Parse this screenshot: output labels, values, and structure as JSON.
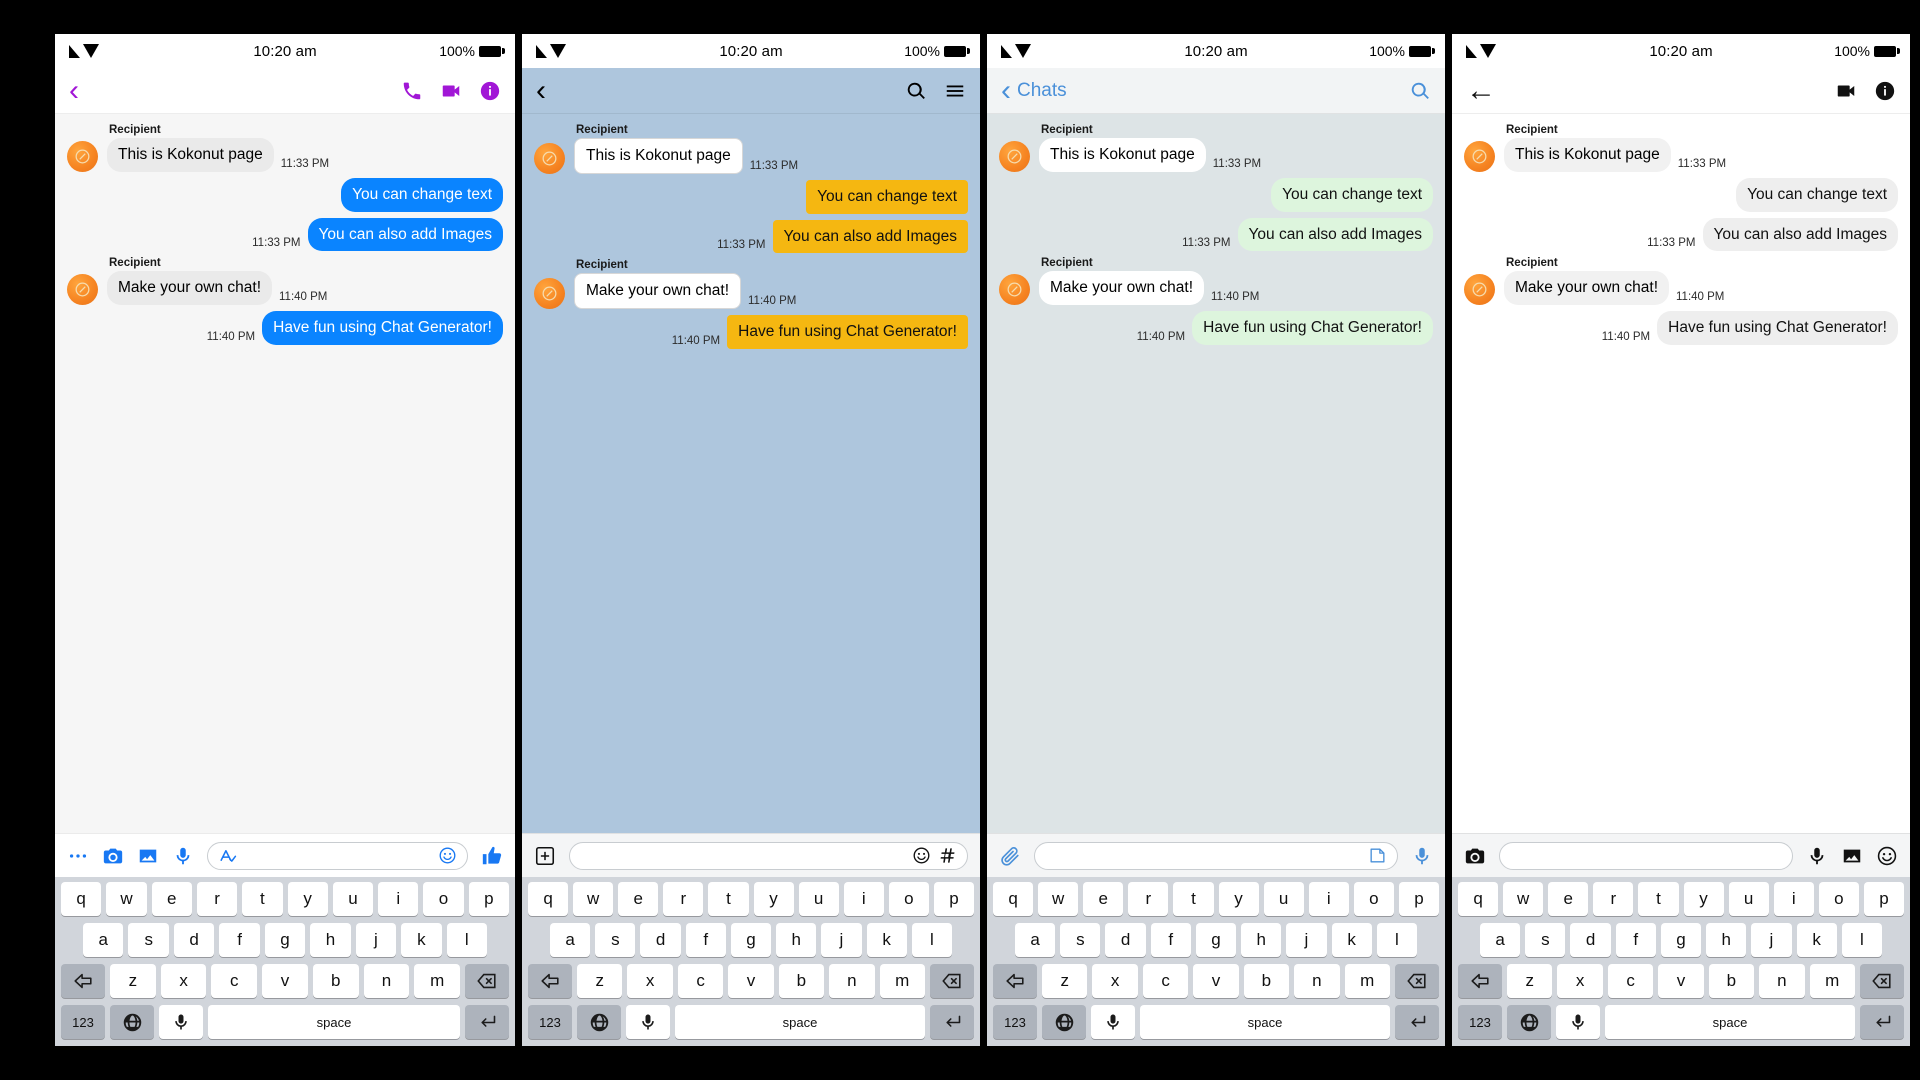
{
  "status_bar": {
    "time": "10:20 am",
    "battery": "100%",
    "icons": [
      "signal-icon",
      "wifi-icon",
      "battery-icon"
    ]
  },
  "conversation": {
    "sender_name": "Recipient",
    "messages": [
      {
        "side": "in",
        "text": "This is Kokonut page",
        "time": "11:33 PM",
        "sender": "Recipient",
        "avatar": true
      },
      {
        "side": "out",
        "text": "You can change text",
        "time": ""
      },
      {
        "side": "out",
        "text": "You can also add Images",
        "time": "11:33 PM"
      },
      {
        "side": "in",
        "text": "Make your own chat!",
        "time": "11:40 PM",
        "sender": "Recipient",
        "avatar": true
      },
      {
        "side": "out",
        "text": "Have fun using Chat Generator!",
        "time": "11:40 PM"
      }
    ]
  },
  "panels": [
    {
      "id": "messenger",
      "name": "messenger-panel",
      "header": {
        "back": "‹",
        "title": "",
        "icons": [
          "phone-icon",
          "video-camera-icon",
          "info-icon"
        ]
      },
      "input": {
        "placeholder": "",
        "left_icons": [
          "more-dots-icon",
          "camera-icon",
          "gallery-icon",
          "microphone-icon"
        ],
        "field_icons": [
          "aa-text-icon",
          "emoji-icon"
        ],
        "right_icons": [
          "thumbs-up-icon"
        ]
      },
      "colors": {
        "accent": "#a116d6",
        "bubble_out": "#0a84ff",
        "bubble_out_text": "#ffffff",
        "bubble_in": "#eaeaea",
        "bubble_in_text": "#000000",
        "thread_bg": "#f6f6f6",
        "header_bg": "#ffffff",
        "icon": "#1878f3"
      }
    },
    {
      "id": "viber",
      "name": "viber-panel",
      "header": {
        "back": "‹",
        "title": "",
        "icons": [
          "search-icon",
          "menu-icon"
        ]
      },
      "input": {
        "placeholder": "",
        "left_icons": [
          "add-icon"
        ],
        "field_icons": [
          "emoji-icon",
          "hashtag-icon"
        ],
        "right_icons": []
      },
      "colors": {
        "accent": "#000000",
        "bubble_out": "#f5b711",
        "bubble_out_text": "#111111",
        "bubble_in": "#ffffff",
        "bubble_in_text": "#000000",
        "thread_bg": "#aec6dd",
        "header_bg": "#aec6dd",
        "icon": "#111111"
      }
    },
    {
      "id": "imessage",
      "name": "imessage-panel",
      "header": {
        "back": "‹",
        "title": "Chats",
        "icons": [
          "search-icon"
        ]
      },
      "input": {
        "placeholder": "",
        "left_icons": [
          "attachment-icon"
        ],
        "field_icons": [
          "sticker-icon"
        ],
        "right_icons": [
          "microphone-icon"
        ]
      },
      "colors": {
        "accent": "#4a90d9",
        "bubble_out": "#ddf5dd",
        "bubble_out_text": "#111111",
        "bubble_in": "#ffffff",
        "bubble_in_text": "#000000",
        "thread_bg": "#dde4e6",
        "header_bg": "#f2f4f5",
        "icon": "#4a90d9"
      }
    },
    {
      "id": "plain",
      "name": "plain-panel",
      "header": {
        "back": "←",
        "title": "",
        "icons": [
          "video-camera-icon",
          "info-icon"
        ]
      },
      "input": {
        "placeholder": "",
        "left_icons": [
          "camera-icon"
        ],
        "field_icons": [],
        "right_icons": [
          "microphone-icon",
          "gallery-icon",
          "emoji-icon"
        ]
      },
      "colors": {
        "accent": "#111111",
        "bubble_out": "#eeeeee",
        "bubble_out_text": "#111111",
        "bubble_in": "#f1f1f1",
        "bubble_in_text": "#000000",
        "thread_bg": "#ffffff",
        "header_bg": "#ffffff",
        "icon": "#111111"
      }
    }
  ],
  "keyboard": {
    "row1": [
      "q",
      "w",
      "e",
      "r",
      "t",
      "y",
      "u",
      "i",
      "o",
      "p"
    ],
    "row2": [
      "a",
      "s",
      "d",
      "f",
      "g",
      "h",
      "j",
      "k",
      "l"
    ],
    "row3": [
      "z",
      "x",
      "c",
      "v",
      "b",
      "n",
      "m"
    ],
    "shift_label": "⇦",
    "backspace_label": "⌧",
    "numbers_label": "123",
    "globe_label": "globe-icon",
    "mic_label": "microphone-icon",
    "space_label": "space",
    "return_label": "↵",
    "bg": "#d1d5db"
  }
}
